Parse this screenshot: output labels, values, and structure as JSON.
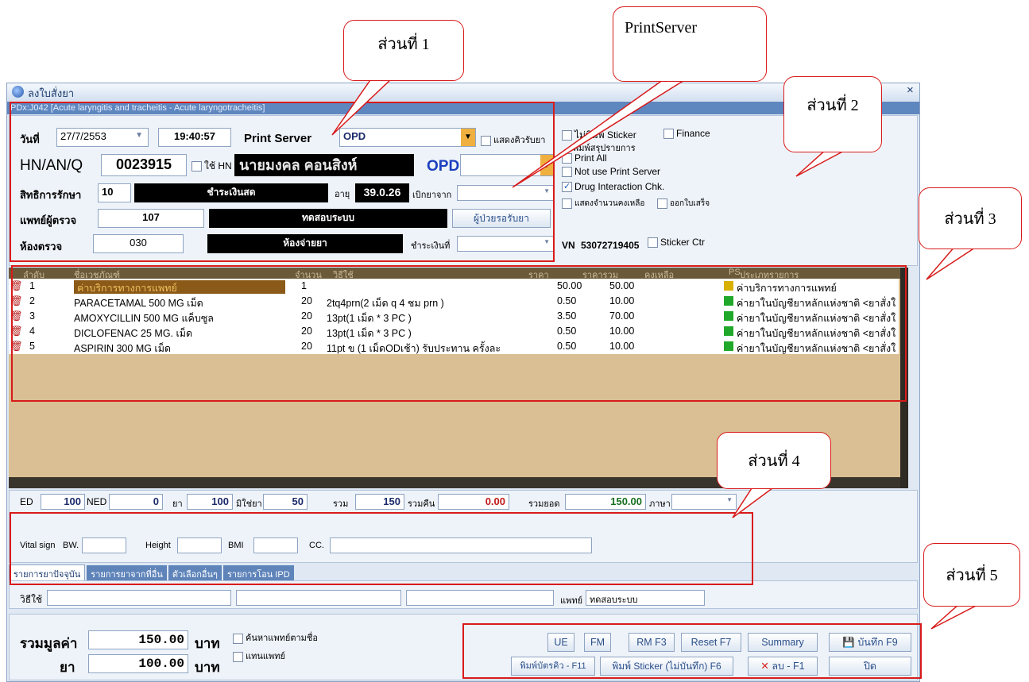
{
  "window": {
    "title": "ลงใบสั่งยา",
    "diagnosis": "PDx:J042 [Acute laryngitis and tracheitis - Acute laryngotracheitis]",
    "close": "×"
  },
  "header": {
    "date_label": "วันที่",
    "date_value": "27/7/2553",
    "time_value": "19:40:57",
    "print_server_label": "Print Server",
    "print_server_value": "OPD",
    "show_queue_label": "แสดงคิวรับยา",
    "hn_label": "HN/AN/Q",
    "hn_value": "0023915",
    "use_hn_label": "ใช้ HN",
    "patient_name": "นายมงคล คอนสิงห์",
    "opd_label": "OPD",
    "rights_label": "สิทธิการรักษา",
    "rights_code": "10",
    "rights_name": "ชำระเงินสด",
    "age_label": "อายุ",
    "age_value": "39.0.26",
    "withdraw_from_label": "เบิกยาจาก",
    "doctor_label": "แพทย์ผู้ตรวจ",
    "doctor_code": "107",
    "doctor_name": "ทดสอบระบบ",
    "waiting_button": "ผู้ป่วยรอรับยา",
    "room_label": "ห้องตรวจ",
    "room_code": "030",
    "room_name": "ห้องจ่ายยา",
    "pay_at_label": "ชำระเงินที่"
  },
  "options": {
    "print_sticker": "ไม่พิมพ์ Sticker",
    "finance": "Finance",
    "print_summary": "พิมพ์สรุปรายการ",
    "print_all": "Print All",
    "not_use_print_server": "Not use Print Server",
    "drug_interaction": "Drug Interaction Chk.",
    "show_remaining": "แสดงจำนวนคงเหลือ",
    "receipt": "ออกใบเสร็จ",
    "vn_label": "VN",
    "vn_value": "53072719405",
    "sticker_ctr": "Sticker Ctr"
  },
  "grid": {
    "columns": [
      "ลำดับ",
      "ชื่อเวชภัณฑ์",
      "จำนวน",
      "วิธีใช้",
      "ราคา",
      "ราคารวม",
      "คงเหลือ",
      "PS",
      "ประเภทรายการ"
    ],
    "rows": [
      {
        "no": "1",
        "name": "ค่าบริการทางการแพทย์",
        "qty": "1",
        "usage": "",
        "price": "50.00",
        "total": "50.00",
        "type": "ค่าบริการทางการแพทย์",
        "ps_color": "#d8b000"
      },
      {
        "no": "2",
        "name": "PARACETAMAL 500 MG เม็ด",
        "qty": "20",
        "usage": "2tq4prn(2 เม็ด q 4 ชม prn )",
        "price": "0.50",
        "total": "10.00",
        "type": "ค่ายาในบัญชียาหลักแห่งชาติ <ยาสั่งใ",
        "ps_color": "#1fa82a"
      },
      {
        "no": "3",
        "name": "AMOXYCILLIN 500 MG แค็บซูล",
        "qty": "20",
        "usage": "13pt(1 เม็ด * 3 PC )",
        "price": "3.50",
        "total": "70.00",
        "type": "ค่ายาในบัญชียาหลักแห่งชาติ <ยาสั่งใ",
        "ps_color": "#1fa82a"
      },
      {
        "no": "4",
        "name": "DICLOFENAC 25 MG. เม็ด",
        "qty": "20",
        "usage": "13pt(1 เม็ด * 3 PC )",
        "price": "0.50",
        "total": "10.00",
        "type": "ค่ายาในบัญชียาหลักแห่งชาติ <ยาสั่งใ",
        "ps_color": "#1fa82a"
      },
      {
        "no": "5",
        "name": "ASPIRIN 300 MG เม็ด",
        "qty": "20",
        "usage": "11pt ข (1 เม็ดODเช้า) รับประทาน ครั้งละ",
        "price": "0.50",
        "total": "10.00",
        "type": "ค่ายาในบัญชียาหลักแห่งชาติ <ยาสั่งใ",
        "ps_color": "#1fa82a"
      }
    ]
  },
  "summary": {
    "ed_label": "ED",
    "ed": "100",
    "ned_label": "NED",
    "ned": "0",
    "drug_label": "ยา",
    "drug": "100",
    "nondrug_label": "มิใช่ยา",
    "nondrug": "50",
    "total_label": "รวม",
    "total": "150",
    "refund_label": "รวมคืน",
    "refund": "0.00",
    "net_label": "รวมยอด",
    "net": "150.00",
    "lang_label": "ภาษา",
    "vital_label": "Vital sign",
    "bw_label": "BW.",
    "height_label": "Height",
    "bmi_label": "BMI",
    "cc_label": "CC."
  },
  "tabs": [
    "รายการยาปัจจุบัน",
    "รายการยาจากที่อื่น",
    "ตัวเลือกอื่นๆ",
    "รายการโอน IPD"
  ],
  "usage_row": {
    "label": "วิธีใช้",
    "doctor_label": "แพทย์",
    "doctor_value": "ทดสอบระบบ"
  },
  "footer": {
    "total_value_label": "รวมมูลค่า",
    "total_value": "150.00",
    "baht1": "บาท",
    "drug_label": "ยา",
    "drug_value": "100.00",
    "baht2": "บาท",
    "search_doctor": "ค้นหาแพทย์ตามชื่อ",
    "substitute_doctor": "แทนแพทย์"
  },
  "buttons": {
    "ue": "UE",
    "fm": "FM",
    "rm": "RM F3",
    "reset": "Reset F7",
    "summary": "Summary",
    "save": "บันทึก F9",
    "print_queue": "พิมพ์บัตรคิว - F11",
    "print_sticker": "พิมพ์ Sticker (ไม่บันทึก) F6",
    "delete": "ลบ - F1",
    "close": "ปิด"
  },
  "callouts": {
    "part1": "ส่วนที่ 1",
    "printserver": "PrintServer",
    "part2": "ส่วนที่ 2",
    "part3": "ส่วนที่ 3",
    "part4": "ส่วนที่ 4",
    "part5": "ส่วนที่ 5"
  }
}
